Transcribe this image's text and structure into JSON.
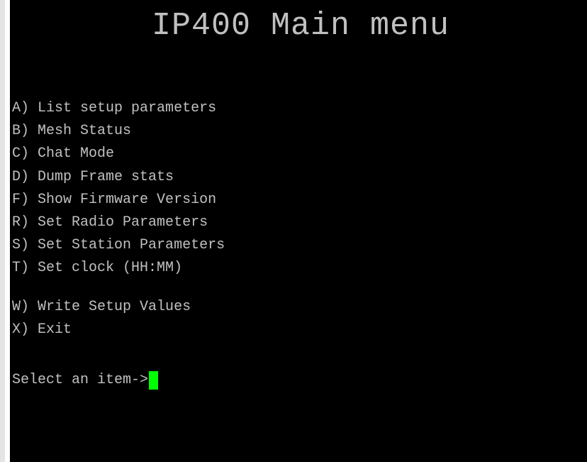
{
  "terminal": {
    "title": "IP400 Main menu",
    "menu": [
      {
        "key": "A)",
        "label": "List setup parameters"
      },
      {
        "key": "B)",
        "label": "Mesh Status"
      },
      {
        "key": "C)",
        "label": "Chat Mode"
      },
      {
        "key": "D)",
        "label": "Dump Frame stats"
      },
      {
        "key": "F)",
        "label": "Show Firmware Version"
      },
      {
        "key": "R)",
        "label": "Set Radio Parameters"
      },
      {
        "key": "S)",
        "label": "Set Station Parameters"
      },
      {
        "key": "T)",
        "label": "Set clock (HH:MM)"
      },
      {
        "key": "W)",
        "label": "Write Setup Values"
      },
      {
        "key": "X)",
        "label": "Exit"
      }
    ],
    "prompt": "Select an item->",
    "colors": {
      "background": "#000000",
      "text": "#c0c0c0",
      "cursor": "#00ff00"
    }
  }
}
